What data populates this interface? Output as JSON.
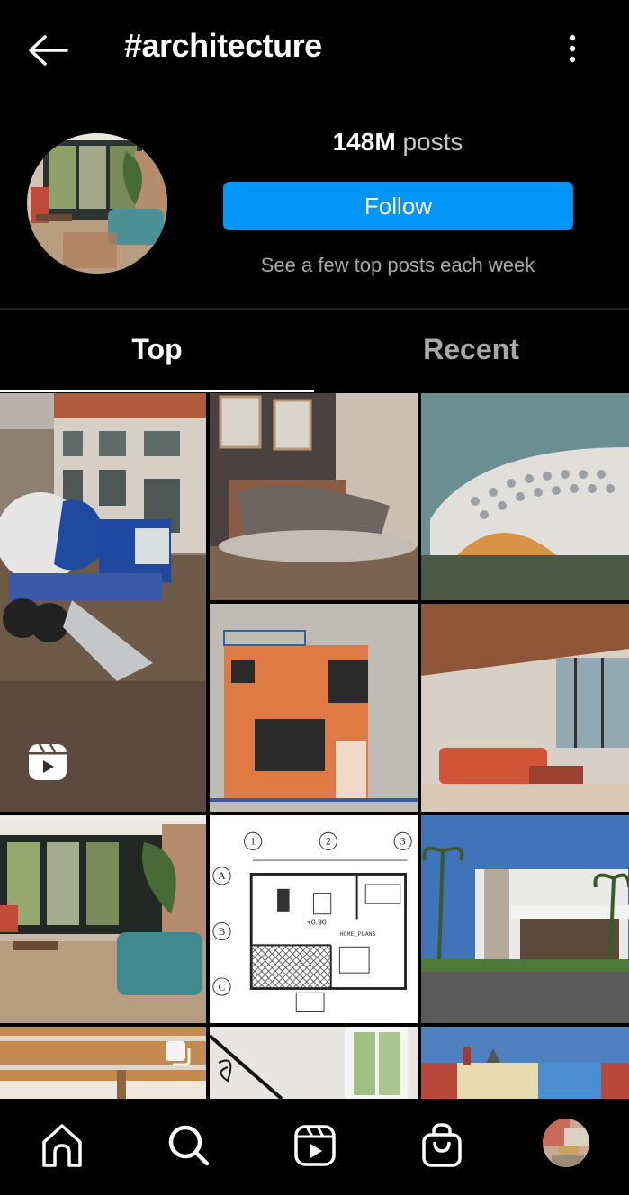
{
  "header": {
    "title": "#architecture",
    "back_icon": "arrow-left-icon",
    "more_icon": "more-vertical-icon"
  },
  "profile": {
    "post_count": "148M",
    "post_label": "posts",
    "follow_label": "Follow",
    "subtitle": "See a few top posts each week"
  },
  "tabs": [
    {
      "label": "Top",
      "active": true
    },
    {
      "label": "Recent",
      "active": false
    }
  ],
  "grid": [
    {
      "subject": "concrete mixer truck at construction site",
      "badge": "reels-icon"
    },
    {
      "subject": "modern bedroom interior"
    },
    {
      "subject": "perforated white facade building"
    },
    {
      "subject": "orange facade elevation drawing"
    },
    {
      "subject": "open living room with wood ceiling"
    },
    {
      "subject": "sunroom living room with teal sofa"
    },
    {
      "subject": "house floor plan",
      "plan_labels": [
        "1",
        "2",
        "3",
        "A",
        "B",
        "C",
        "+0.90",
        "HOME_PLANS"
      ]
    },
    {
      "subject": "modern white villa with palm trees"
    },
    {
      "subject": "interior with wood ceiling beams",
      "badge": "carousel-icon"
    },
    {
      "subject": "white stairwell with iron railing"
    },
    {
      "subject": "colorful row houses"
    }
  ],
  "colors": {
    "accent": "#0095f6",
    "background": "#000000",
    "muted_text": "#a8a8a8"
  },
  "bottom_nav": [
    {
      "name": "home",
      "icon": "home-icon"
    },
    {
      "name": "search",
      "icon": "search-icon"
    },
    {
      "name": "reels",
      "icon": "reels-icon"
    },
    {
      "name": "shop",
      "icon": "shopping-bag-icon"
    },
    {
      "name": "profile",
      "icon": "profile-avatar"
    }
  ]
}
